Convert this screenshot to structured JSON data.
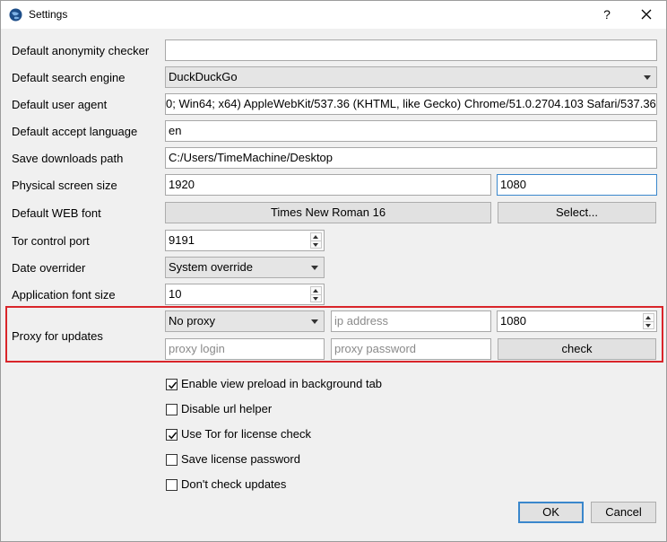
{
  "window": {
    "title": "Settings",
    "help": "?"
  },
  "fields": {
    "anonymity_checker": {
      "label": "Default anonymity checker",
      "value": ""
    },
    "search_engine": {
      "label": "Default search engine",
      "value": "DuckDuckGo"
    },
    "user_agent": {
      "label": "Default user agent",
      "value": "0; Win64; x64) AppleWebKit/537.36 (KHTML, like Gecko) Chrome/51.0.2704.103 Safari/537.36"
    },
    "accept_language": {
      "label": "Default accept language",
      "value": "en"
    },
    "downloads_path": {
      "label": "Save downloads path",
      "value": "C:/Users/TimeMachine/Desktop"
    },
    "screen_size": {
      "label": "Physical screen size",
      "width": "1920",
      "height": "1080"
    },
    "web_font": {
      "label": "Default WEB font",
      "value": "Times New Roman 16",
      "select_label": "Select..."
    },
    "tor_port": {
      "label": "Tor control port",
      "value": "9191"
    },
    "date_overrider": {
      "label": "Date overrider",
      "value": "System override"
    },
    "app_font_size": {
      "label": "Application font size",
      "value": "10"
    }
  },
  "proxy": {
    "label": "Proxy for updates",
    "type": "No proxy",
    "ip_placeholder": "ip address",
    "port": "1080",
    "login_placeholder": "proxy login",
    "password_placeholder": "proxy password",
    "check_label": "check",
    "highlight_color": "#d9252a"
  },
  "checkboxes": [
    {
      "label": "Enable view preload in background tab",
      "checked": true
    },
    {
      "label": "Disable url helper",
      "checked": false
    },
    {
      "label": "Use Tor for license check",
      "checked": true
    },
    {
      "label": "Save license password",
      "checked": false
    },
    {
      "label": "Don't check updates",
      "checked": false
    }
  ],
  "buttons": {
    "ok": "OK",
    "cancel": "Cancel"
  },
  "colors": {
    "focus": "#3a87cc",
    "background": "#f0f0f0"
  }
}
